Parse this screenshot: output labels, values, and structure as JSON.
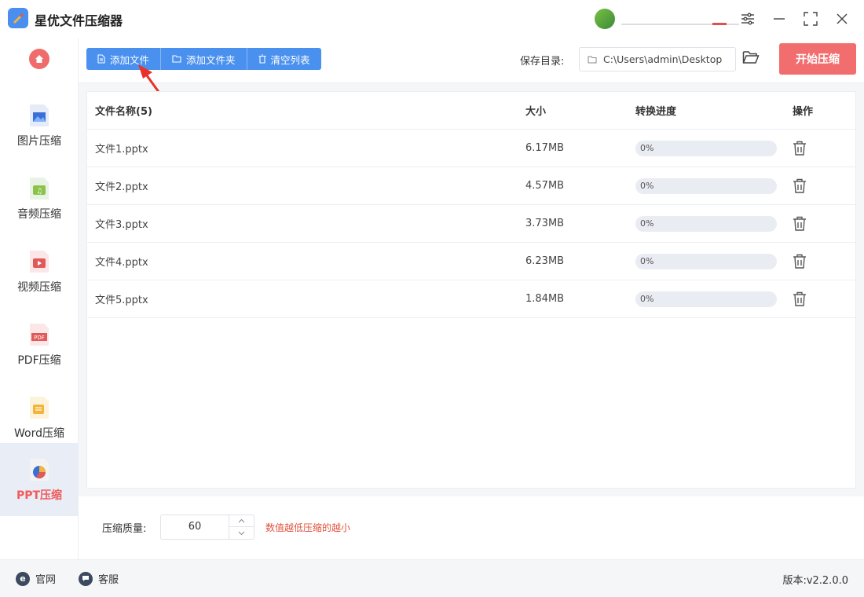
{
  "app": {
    "title": "星优文件压缩器"
  },
  "sidebar": {
    "items": [
      {
        "label": "图片压缩"
      },
      {
        "label": "音频压缩"
      },
      {
        "label": "视频压缩"
      },
      {
        "label": "PDF压缩"
      },
      {
        "label": "Word压缩"
      },
      {
        "label": "PPT压缩"
      }
    ],
    "active_index": 5
  },
  "toolbar": {
    "add_file": "添加文件",
    "add_folder": "添加文件夹",
    "clear_list": "清空列表",
    "save_label": "保存目录:",
    "save_path": "C:\\Users\\admin\\Desktop",
    "start": "开始压缩"
  },
  "table": {
    "headers": {
      "name": "文件名称(5)",
      "size": "大小",
      "progress": "转换进度",
      "action": "操作"
    },
    "rows": [
      {
        "name": "文件1.pptx",
        "size": "6.17MB",
        "progress_text": "0%",
        "progress": 0
      },
      {
        "name": "文件2.pptx",
        "size": "4.57MB",
        "progress_text": "0%",
        "progress": 0
      },
      {
        "name": "文件3.pptx",
        "size": "3.73MB",
        "progress_text": "0%",
        "progress": 0
      },
      {
        "name": "文件4.pptx",
        "size": "6.23MB",
        "progress_text": "0%",
        "progress": 0
      },
      {
        "name": "文件5.pptx",
        "size": "1.84MB",
        "progress_text": "0%",
        "progress": 0
      }
    ]
  },
  "quality": {
    "label": "压缩质量:",
    "value": "60",
    "hint": "数值越低压缩的越小"
  },
  "footer": {
    "website": "官网",
    "support": "客服",
    "version": "版本:v2.2.0.0"
  },
  "colors": {
    "accent_blue": "#4a90ee",
    "start_red": "#f26e6e",
    "active_red": "#f05b5b",
    "hint_red": "#e0533c"
  }
}
